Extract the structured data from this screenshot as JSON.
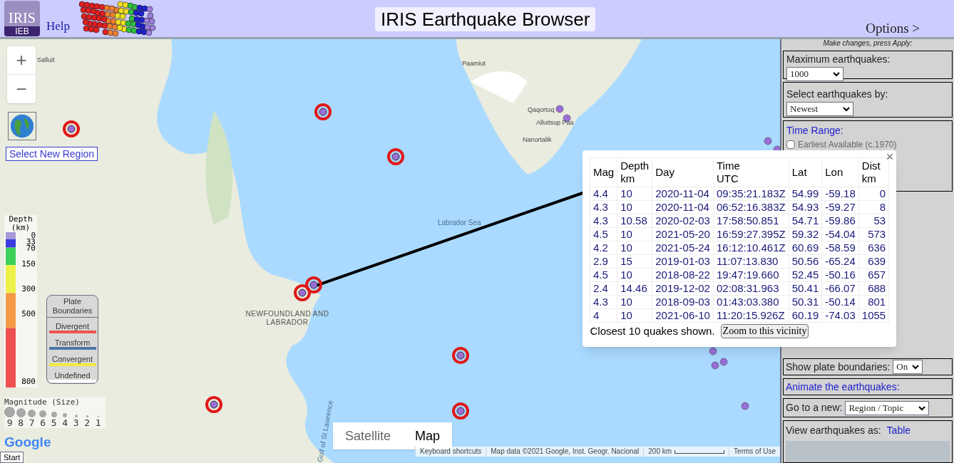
{
  "header": {
    "logo_text": "IRIS",
    "logo_badge": "IEB",
    "help": "Help",
    "title": "IRIS Earthquake Browser",
    "options": "Options >"
  },
  "map": {
    "zoom_in": "+",
    "zoom_out": "−",
    "select_region": "Select New Region",
    "labels": [
      {
        "text": "Salluit",
        "kind": "place"
      },
      {
        "text": "Paamiut",
        "kind": "place"
      },
      {
        "text": "Qaqortoq",
        "kind": "place"
      },
      {
        "text": "Alluitsup Paa",
        "kind": "place"
      },
      {
        "text": "Nanortalik",
        "kind": "place"
      },
      {
        "text": "Labrador Sea",
        "kind": "sea"
      },
      {
        "text": "NEWFOUNDLAND AND LABRADOR",
        "kind": "region"
      },
      {
        "text": "Gulf of St Lawrence",
        "kind": "sea"
      }
    ],
    "depth_legend": {
      "title": "Depth (km)",
      "ticks": [
        "0",
        "33",
        "70",
        "150",
        "300",
        "500",
        "800"
      ]
    },
    "plate_legend": {
      "title": "Plate Boundaries",
      "items": [
        {
          "label": "Divergent",
          "color": "#ef5350"
        },
        {
          "label": "Transform",
          "color": "#4a76a8"
        },
        {
          "label": "Convergent",
          "color": "#f0ea3c"
        },
        {
          "label": "Undefined",
          "color": "#ffffff"
        }
      ]
    },
    "magnitude_legend": {
      "title": "Magnitude (Size)",
      "sizes": [
        "9",
        "8",
        "7",
        "6",
        "5",
        "4",
        "3",
        "2",
        "1"
      ]
    },
    "map_types": [
      {
        "label": "Satellite",
        "selected": false
      },
      {
        "label": "Map",
        "selected": true
      }
    ],
    "footer": [
      "Keyboard shortcuts",
      "Map data ©2021 Google, Inst. Geogr. Nacional",
      "200 km",
      "Terms of Use"
    ],
    "google": "Google",
    "start": "Start"
  },
  "popup": {
    "close": "×",
    "columns": [
      "Mag",
      "Depth km",
      "Day",
      "Time UTC",
      "Lat",
      "Lon",
      "Dist km"
    ],
    "rows": [
      [
        "4.4",
        "10",
        "2020-11-04",
        "09:35:21.183Z",
        "54.99",
        "-59.18",
        "0"
      ],
      [
        "4.3",
        "10",
        "2020-11-04",
        "06:52:16.383Z",
        "54.93",
        "-59.27",
        "8"
      ],
      [
        "4.3",
        "10.58",
        "2020-02-03",
        "17:58:50.851",
        "54.71",
        "-59.86",
        "53"
      ],
      [
        "4.5",
        "10",
        "2021-05-20",
        "16:59:27.395Z",
        "59.32",
        "-54.04",
        "573"
      ],
      [
        "4.2",
        "10",
        "2021-05-24",
        "16:12:10.461Z",
        "60.69",
        "-58.59",
        "636"
      ],
      [
        "2.9",
        "15",
        "2019-01-03",
        "11:07:13.830",
        "50.56",
        "-65.24",
        "639"
      ],
      [
        "4.5",
        "10",
        "2018-08-22",
        "19:47:19.660",
        "52.45",
        "-50.16",
        "657"
      ],
      [
        "2.4",
        "14.46",
        "2019-12-02",
        "02:08:31.963",
        "50.41",
        "-66.07",
        "688"
      ],
      [
        "4.3",
        "10",
        "2018-09-03",
        "01:43:03.380",
        "50.31",
        "-50.14",
        "801"
      ],
      [
        "4",
        "10",
        "2021-06-10",
        "11:20:15.926Z",
        "60.19",
        "-74.03",
        "1055"
      ]
    ],
    "note": "Closest 10 quakes shown.",
    "button": "Zoom to this vicinity"
  },
  "sidebar": {
    "hint": "Make changes, press Apply:",
    "max": {
      "label": "Maximum earthquakes:",
      "value": "1000"
    },
    "select_by": {
      "label": "Select earthquakes by:",
      "value": "Newest"
    },
    "time_range": {
      "label": "Time Range:",
      "earliest": {
        "label": "Earliest Available (c.1970)",
        "checked": false
      }
    },
    "plate_boundaries": {
      "label": "Show plate boundaries:",
      "value": "On"
    },
    "animate": "Animate the earthquakes:",
    "goto": {
      "label": "Go to a new:",
      "value": "Region / Topic"
    },
    "view": {
      "label": "View earthquakes as:",
      "link": "Table"
    }
  }
}
